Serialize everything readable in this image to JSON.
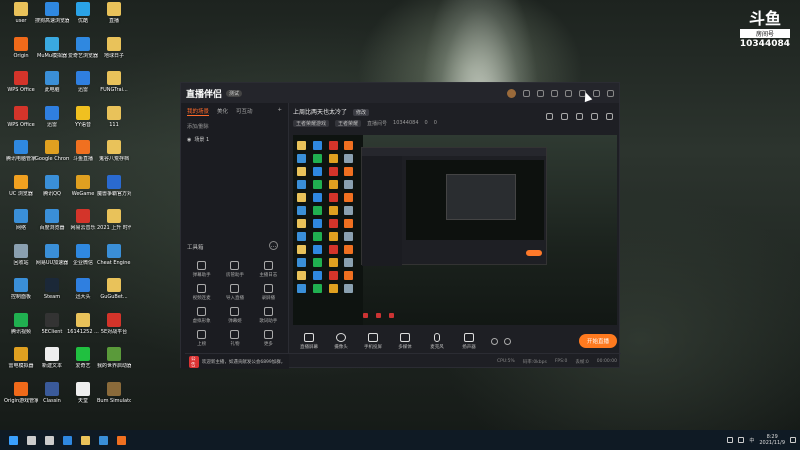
{
  "desktop": {
    "icons": [
      {
        "label": "user",
        "color": "#e9c25a",
        "col": 0,
        "row": 0
      },
      {
        "label": "搜狗高速浏览器",
        "color": "#2f88e0",
        "col": 1,
        "row": 0
      },
      {
        "label": "优酷",
        "color": "#2aa3e8",
        "col": 2,
        "row": 0
      },
      {
        "label": "直播",
        "color": "#e9c25a",
        "col": 3,
        "row": 0
      },
      {
        "label": "Origin",
        "color": "#f06a1a",
        "col": 0,
        "row": 1
      },
      {
        "label": "MuMu模拟器",
        "color": "#3aa9e0",
        "col": 1,
        "row": 1
      },
      {
        "label": "爱奇艺浏览器",
        "color": "#2f88e0",
        "col": 2,
        "row": 1
      },
      {
        "label": "地球日子",
        "color": "#e9c25a",
        "col": 3,
        "row": 1
      },
      {
        "label": "WPS Office",
        "color": "#d4342a",
        "col": 0,
        "row": 2
      },
      {
        "label": "此电脑",
        "color": "#3a8fd8",
        "col": 1,
        "row": 2
      },
      {
        "label": "迅雷",
        "color": "#2f7fe0",
        "col": 2,
        "row": 2
      },
      {
        "label": "FUNGTrai...",
        "color": "#e9c25a",
        "col": 3,
        "row": 2
      },
      {
        "label": "WPS Office",
        "color": "#d4342a",
        "col": 0,
        "row": 3
      },
      {
        "label": "迅雷",
        "color": "#2f7fe0",
        "col": 1,
        "row": 3
      },
      {
        "label": "YY语音",
        "color": "#f0c020",
        "col": 2,
        "row": 3
      },
      {
        "label": "111",
        "color": "#e9c25a",
        "col": 3,
        "row": 3
      },
      {
        "label": "腾讯电脑管家",
        "color": "#2f88e0",
        "col": 0,
        "row": 4
      },
      {
        "label": "Google Chrome",
        "color": "#e0a020",
        "col": 1,
        "row": 4
      },
      {
        "label": "斗鱼直播",
        "color": "#f07020",
        "col": 2,
        "row": 4
      },
      {
        "label": "鬼谷八荒存档",
        "color": "#e9c25a",
        "col": 3,
        "row": 4
      },
      {
        "label": "UC 浏览器",
        "color": "#f0a020",
        "col": 0,
        "row": 5
      },
      {
        "label": "腾讯QQ",
        "color": "#3a8fd8",
        "col": 1,
        "row": 5
      },
      {
        "label": "WeGame",
        "color": "#e0a020",
        "col": 2,
        "row": 5
      },
      {
        "label": "魔兽争霸官方对战平台",
        "color": "#2a6ad0",
        "col": 3,
        "row": 5
      },
      {
        "label": "网络",
        "color": "#3a8fd8",
        "col": 0,
        "row": 6
      },
      {
        "label": "百度浏览器",
        "color": "#3a8fd8",
        "col": 1,
        "row": 6
      },
      {
        "label": "网易云音乐",
        "color": "#d4342a",
        "col": 2,
        "row": 6
      },
      {
        "label": "2021 上升 时代 工商...",
        "color": "#e9c25a",
        "col": 3,
        "row": 6
      },
      {
        "label": "回收站",
        "color": "#8aa0b0",
        "col": 0,
        "row": 7
      },
      {
        "label": "网易UU加速器",
        "color": "#3a8fd8",
        "col": 1,
        "row": 7
      },
      {
        "label": "企业微信",
        "color": "#2f88e0",
        "col": 2,
        "row": 7
      },
      {
        "label": "Cheat Engine 7.2",
        "color": "#3a8fd8",
        "col": 3,
        "row": 7
      },
      {
        "label": "控制面板",
        "color": "#3a8fd8",
        "col": 0,
        "row": 8
      },
      {
        "label": "Steam",
        "color": "#1b2838",
        "col": 1,
        "row": 8
      },
      {
        "label": "迅大头",
        "color": "#2f7fe0",
        "col": 2,
        "row": 8
      },
      {
        "label": "GuGuBet...",
        "color": "#e9c25a",
        "col": 3,
        "row": 8
      },
      {
        "label": "腾讯视频",
        "color": "#20b050",
        "col": 0,
        "row": 9
      },
      {
        "label": "5EClient",
        "color": "#333333",
        "col": 1,
        "row": 9
      },
      {
        "label": "16141252 ...",
        "color": "#e9c25a",
        "col": 2,
        "row": 9
      },
      {
        "label": "5E对战平台",
        "color": "#d4342a",
        "col": 3,
        "row": 9
      },
      {
        "label": "雷电模拟器",
        "color": "#e0a020",
        "col": 0,
        "row": 10
      },
      {
        "label": "新建文本",
        "color": "#eeeeee",
        "col": 1,
        "row": 10
      },
      {
        "label": "爱奇艺",
        "color": "#20c040",
        "col": 2,
        "row": 10
      },
      {
        "label": "我的世界启动器",
        "color": "#5a9a3a",
        "col": 3,
        "row": 10
      },
      {
        "label": "Origin游戏管家",
        "color": "#f06a1a",
        "col": 0,
        "row": 11
      },
      {
        "label": "Classin",
        "color": "#3a5a9a",
        "col": 1,
        "row": 11
      },
      {
        "label": "天堂",
        "color": "#eeeeee",
        "col": 2,
        "row": 11
      },
      {
        "label": "Bum Simulator",
        "color": "#8a6a3a",
        "col": 3,
        "row": 11
      }
    ]
  },
  "brand": {
    "logo": "斗鱼",
    "sub": "房间号",
    "room_number": "10344084"
  },
  "app": {
    "title": "直播伴侣",
    "version": "测试",
    "tabs": [
      "我的场景",
      "美化",
      "可互动"
    ],
    "scene_header": "添加/删除",
    "scene_item": "场景 1",
    "toolbox_title": "工具箱",
    "tools": [
      "弹幕助手",
      "房管助手",
      "主播日志",
      "视频连麦",
      "导入直播",
      "录屏播",
      "虚拟形象",
      "弹幕姬",
      "歌词助手",
      "上榜",
      "礼物",
      "更多"
    ],
    "room_title": "上周比两天也太冷了",
    "room_edit": "修改",
    "room_meta": {
      "category": "王者荣耀游戏",
      "tag": "王者荣耀",
      "room_label": "直播间号",
      "room_id": "10344084",
      "fans": "0",
      "gifts": "0"
    },
    "controls": [
      "直播屏幕",
      "摄像头",
      "手机投屏",
      "多媒体",
      "麦克风",
      "扬声器"
    ],
    "live_button": "开始直播",
    "notice_badge": "公告",
    "notice_text": "欢迎新主播，如遇贡献发公会6899加群，请点获取专号享受权益",
    "status": {
      "cpu": "CPU:5%",
      "bitrate": "码率:0kbps",
      "fps": "FPS:0",
      "drop": "丢帧:0",
      "time": "00:00:00"
    }
  },
  "taskbar": {
    "time": "8:29",
    "date": "2021/11/9",
    "lang": "中",
    "items": [
      {
        "name": "start-icon",
        "color": "#3aa0ff"
      },
      {
        "name": "search-icon",
        "color": "#cccccc"
      },
      {
        "name": "task-view-icon",
        "color": "#cccccc"
      },
      {
        "name": "edge-icon",
        "color": "#2f88e0"
      },
      {
        "name": "explorer-icon",
        "color": "#e9c25a"
      },
      {
        "name": "store-icon",
        "color": "#3a8fd8"
      },
      {
        "name": "douyu-live-icon",
        "color": "#f07020"
      }
    ]
  }
}
